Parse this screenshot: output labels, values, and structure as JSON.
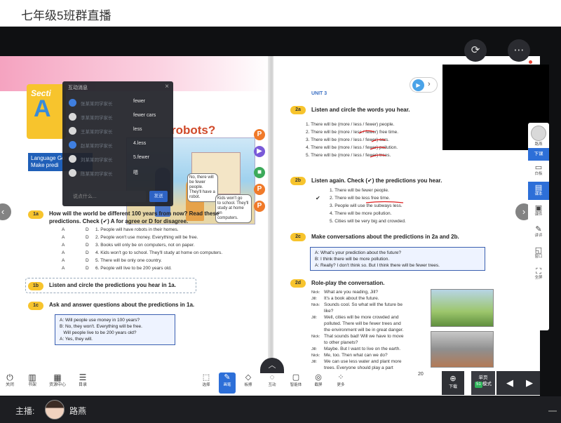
{
  "window": {
    "title": "七年级5班群直播"
  },
  "book_left": {
    "section_label": "Secti",
    "section_letter": "A",
    "lang_goals": "Language Go\nMake predi",
    "robots_title": "robots?",
    "bubble1": "No, there will\nbe fewer people.\nThey'll have a robot.",
    "bubble2": "Kids won't go\nto school. They'll\nstudy at home on\ncomputers.",
    "ex_1a": {
      "label": "1a",
      "title": "How will the world be different 100 years from now? Read these",
      "title2": "predictions. Check (✔) A for agree or D for disagree."
    },
    "predictions_1a": [
      {
        "a": "A",
        "d": "D",
        "text": "1. People will have robots in their homes."
      },
      {
        "a": "A",
        "d": "D",
        "text": "2. People won't use money. Everything will be free."
      },
      {
        "a": "A",
        "d": "D",
        "text": "3. Books will only be on computers, not on paper."
      },
      {
        "a": "A",
        "d": "D",
        "text": "4. Kids won't go to school. They'll study at home on computers."
      },
      {
        "a": "A",
        "d": "D",
        "text": "5. There will be only one country."
      },
      {
        "a": "A",
        "d": "D",
        "text": "6. People will live to be 200 years old."
      }
    ],
    "ex_1b": {
      "label": "1b",
      "title": "Listen and circle the predictions you hear in 1a."
    },
    "ex_1c": {
      "label": "1c",
      "title": "Ask and answer questions about the predictions in 1a."
    },
    "dialog_1c": [
      "A: Will people use money in 100 years?",
      "B: No, they won't. Everything will be free.",
      "   Will people live to be 200 years old?",
      "A: Yes, they will."
    ]
  },
  "book_right": {
    "unit": "UNIT 3",
    "ex_2a": {
      "label": "2a",
      "title": "Listen and circle the words you hear."
    },
    "lines_2a": [
      "1. There will be (more / less / fewer) people.",
      "2. There will be (more / less / fewer) free time.",
      "3. There will be (more / less / fewer) cars.",
      "4. There will be (more / less / fewer) pollution.",
      "5. There will be (more / less / fewer) trees."
    ],
    "ex_2b": {
      "label": "2b",
      "title": "Listen again. Check (✔) the predictions you hear."
    },
    "lines_2b": [
      "1. There will be fewer people.",
      "2. There will be less free time.",
      "3. People will use the subways less.",
      "4. There will be more pollution.",
      "5. Cities will be very big and crowded."
    ],
    "check_mark": "✔",
    "ex_2c": {
      "label": "2c",
      "title": "Make conversations about the predictions in 2a and 2b."
    },
    "dialog_2c": [
      "A: What's your prediction about the future?",
      "B: I think there will be more pollution.",
      "A: Really? I don't think so. But I think there will be fewer trees."
    ],
    "ex_2d": {
      "label": "2d",
      "title": "Role-play the conversation."
    },
    "dialog_2d": [
      {
        "who": "Nick:",
        "text": "What are you reading, Jill?"
      },
      {
        "who": "Jill:",
        "text": "It's a book about the future."
      },
      {
        "who": "Nick:",
        "text": "Sounds cool. So what will the future be"
      },
      {
        "who": "",
        "text": "like?"
      },
      {
        "who": "Jill:",
        "text": "Well, cities will be more crowded and"
      },
      {
        "who": "",
        "text": "polluted. There will be fewer trees and"
      },
      {
        "who": "",
        "text": "the environment will be in great danger."
      },
      {
        "who": "Nick:",
        "text": "That sounds bad! Will we have to move"
      },
      {
        "who": "",
        "text": "to other planets?"
      },
      {
        "who": "Jill:",
        "text": "Maybe. But I want to live on the earth."
      },
      {
        "who": "Nick:",
        "text": "Me, too. Then what can we do?"
      },
      {
        "who": "Jill:",
        "text": "We can use less water and plant more"
      },
      {
        "who": "",
        "text": "trees. Everyone should play a part"
      }
    ]
  },
  "chat": {
    "header": "互动消息",
    "messages": [
      {
        "name": "张某某同学家长",
        "msg": "fewer"
      },
      {
        "name": "李某某同学家长",
        "msg": "fewer cars"
      },
      {
        "name": "王某某同学家长",
        "msg": "less"
      },
      {
        "name": "赵某某同学家长",
        "msg": "4.less"
      },
      {
        "name": "刘某某同学家长",
        "msg": "5.fewer"
      },
      {
        "name": "陈某某同学家长",
        "msg": "嗯"
      }
    ],
    "input_placeholder": "说点什么...",
    "send_label": "发送"
  },
  "right_tools": [
    {
      "label": "路燕",
      "icon": "person-icon"
    },
    {
      "label": "下课",
      "icon": "stop-icon",
      "active": true
    },
    {
      "label": "白板",
      "icon": "whiteboard-icon"
    },
    {
      "label": "课本",
      "icon": "book-icon"
    },
    {
      "label": "课件",
      "icon": "courseware-icon"
    },
    {
      "label": "讲评",
      "icon": "review-icon"
    },
    {
      "label": "窗口",
      "icon": "window-icon"
    },
    {
      "label": "全屏",
      "icon": "fullscreen-icon"
    }
  ],
  "bottom_left": [
    {
      "label": "关闭",
      "icon": "power-icon"
    },
    {
      "label": "书架",
      "icon": "bookshelf-icon"
    },
    {
      "label": "资源中心",
      "icon": "resource-icon"
    },
    {
      "label": "目录",
      "icon": "catalog-icon"
    }
  ],
  "bottom_center": [
    {
      "label": "选择",
      "icon": "select-icon"
    },
    {
      "label": "画笔",
      "icon": "pen-icon",
      "active": true
    },
    {
      "label": "板擦",
      "icon": "eraser-icon"
    },
    {
      "label": "互动",
      "icon": "interact-icon"
    },
    {
      "label": "智能体",
      "icon": "ai-icon"
    },
    {
      "label": "截屏",
      "icon": "screenshot-icon"
    },
    {
      "label": "更多",
      "icon": "more-icon"
    }
  ],
  "bottom_right": {
    "page_counter": "20",
    "download_label": "下载",
    "page_mode_line1": "单页",
    "page_mode_num": "51",
    "page_mode_line2": "模式"
  },
  "host": {
    "label": "主播:",
    "name": "路燕"
  },
  "colors": {
    "accent": "#2d6fd8",
    "chat_bg": "#23242a",
    "red_dot": "#ee4433"
  }
}
